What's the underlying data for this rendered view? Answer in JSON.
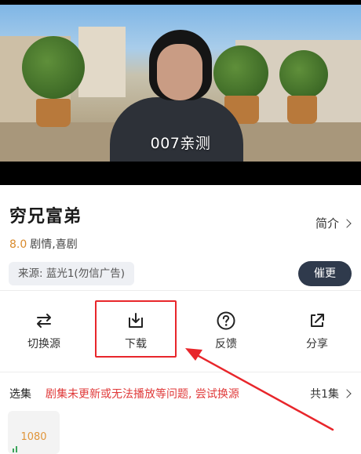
{
  "video": {
    "subtitle": "007亲测"
  },
  "show": {
    "title": "穷兄富弟",
    "intro_label": "简介",
    "score": "8.0",
    "genres": "剧情,喜剧",
    "source_label": "来源: 蓝光1(勿信广告)",
    "urge_label": "催更"
  },
  "actions": [
    {
      "label": "切换源",
      "icon": "switch-source-icon"
    },
    {
      "label": "下载",
      "icon": "download-icon"
    },
    {
      "label": "反馈",
      "icon": "feedback-question-icon"
    },
    {
      "label": "分享",
      "icon": "share-icon"
    }
  ],
  "episodes": {
    "label": "选集",
    "warning": "剧集未更新或无法播放等问题, 尝试换源",
    "count_label": "共1集",
    "items": [
      {
        "label": "1080"
      }
    ]
  },
  "colors": {
    "score": "#d98a2b",
    "warning": "#e03a3a",
    "urge_button": "#2f3a4c",
    "highlight": "#e8262b"
  }
}
